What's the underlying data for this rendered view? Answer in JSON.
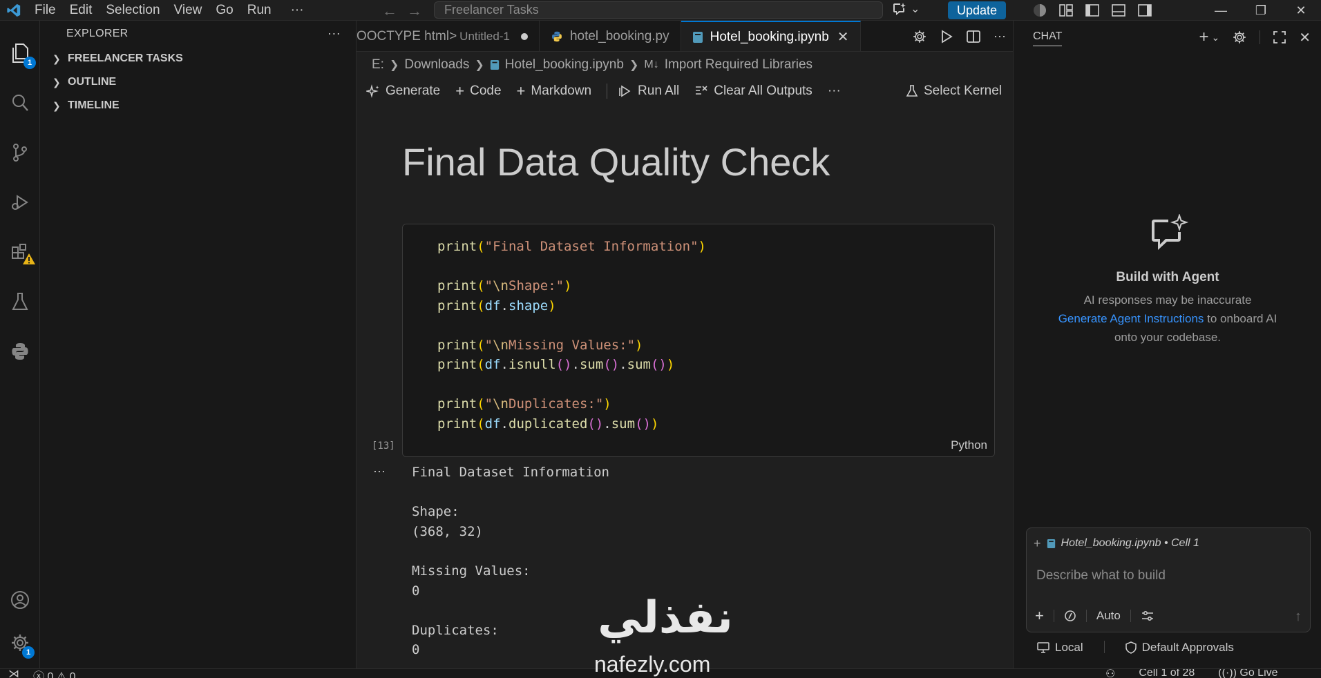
{
  "titlebar": {
    "menu": [
      "File",
      "Edit",
      "Selection",
      "View",
      "Go",
      "Run"
    ],
    "more": "···",
    "search_text": "Freelancer Tasks",
    "update_label": "Update"
  },
  "activity": {
    "explorer_badge": "1",
    "settings_badge": "1"
  },
  "sidebar": {
    "title": "EXPLORER",
    "dots": "···",
    "sections": [
      "FREELANCER TASKS",
      "OUTLINE",
      "TIMELINE"
    ]
  },
  "tabs": [
    {
      "label": "OOCTYPE html>",
      "desc": "Untitled-1"
    },
    {
      "label": "hotel_booking.py"
    },
    {
      "label": "Hotel_booking.ipynb"
    }
  ],
  "breadcrumb": [
    "E:",
    "Downloads",
    "Hotel_booking.ipynb",
    "Import Required Libraries"
  ],
  "breadcrumb_md": "M↓",
  "toolbar": {
    "generate": "Generate",
    "code": "Code",
    "markdown": "Markdown",
    "run_all": "Run All",
    "clear_outputs": "Clear All Outputs",
    "more": "···",
    "select_kernel": "Select Kernel"
  },
  "notebook": {
    "heading": "Final Data Quality Check",
    "exec_count": "[13]",
    "language": "Python",
    "out_dots": "···",
    "output_lines": [
      "Final Dataset Information",
      "",
      "Shape:",
      "(368, 32)",
      "",
      "Missing Values:",
      "0",
      "",
      "Duplicates:",
      "0"
    ]
  },
  "chat": {
    "title": "CHAT",
    "heading": "Build with Agent",
    "line1": "AI responses may be inaccurate",
    "link": "Generate Agent Instructions",
    "line2_rest": " to onboard AI",
    "line3": "onto your codebase.",
    "context_file": "Hotel_booking.ipynb • Cell 1",
    "placeholder": "Describe what to build",
    "mode": "Auto",
    "footer_local": "Local",
    "footer_approvals": "Default Approvals"
  },
  "status": {
    "errors": "0",
    "warnings": "0",
    "cell": "Cell 1 of 28",
    "golive": "Go Live"
  },
  "watermark": {
    "arabic": "نفذلي",
    "url": "nafezly.com"
  }
}
